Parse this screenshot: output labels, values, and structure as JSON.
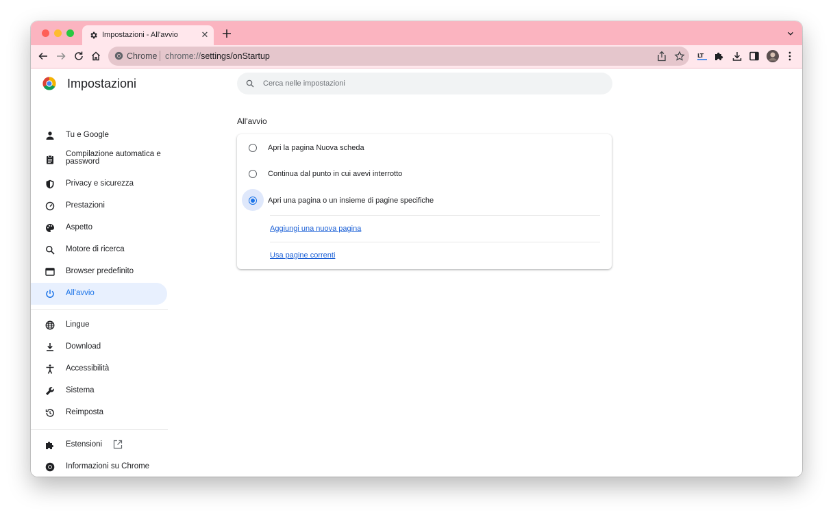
{
  "browser": {
    "tab": {
      "title": "Impostazioni - All'avvio",
      "icon": "gear-icon"
    },
    "omnibox": {
      "site_label": "Chrome",
      "url_prefix": "chrome://",
      "url_path": "settings/onStartup"
    }
  },
  "app": {
    "title": "Impostazioni"
  },
  "search": {
    "placeholder": "Cerca nelle impostazioni"
  },
  "sidebar": {
    "items": [
      {
        "label": "Tu e Google",
        "icon": "person-icon"
      },
      {
        "label": "Compilazione automatica e password",
        "icon": "clipboard-icon"
      },
      {
        "label": "Privacy e sicurezza",
        "icon": "shield-icon"
      },
      {
        "label": "Prestazioni",
        "icon": "speedometer-icon"
      },
      {
        "label": "Aspetto",
        "icon": "palette-icon"
      },
      {
        "label": "Motore di ricerca",
        "icon": "search-icon"
      },
      {
        "label": "Browser predefinito",
        "icon": "browser-window-icon"
      },
      {
        "label": "All'avvio",
        "icon": "power-icon",
        "active": true
      },
      {
        "label": "Lingue",
        "icon": "globe-icon"
      },
      {
        "label": "Download",
        "icon": "download-icon"
      },
      {
        "label": "Accessibilità",
        "icon": "accessibility-icon"
      },
      {
        "label": "Sistema",
        "icon": "wrench-icon"
      },
      {
        "label": "Reimposta",
        "icon": "history-icon"
      },
      {
        "label": "Estensioni",
        "icon": "puzzle-icon"
      },
      {
        "label": "Informazioni su Chrome",
        "icon": "chrome-icon"
      }
    ]
  },
  "startup": {
    "title": "All'avvio",
    "options": [
      {
        "label": "Apri la pagina Nuova scheda",
        "selected": false
      },
      {
        "label": "Continua dal punto in cui avevi interrotto",
        "selected": false
      },
      {
        "label": "Apri una pagina o un insieme di pagine specifiche",
        "selected": true
      }
    ],
    "add_page_link": "Aggiungi una nuova pagina",
    "use_current_link": "Usa pagine correnti"
  },
  "colors": {
    "accent": "#1a73e8",
    "tabstrip": "#fbb4c0",
    "toolbar": "#ffe7ec"
  }
}
